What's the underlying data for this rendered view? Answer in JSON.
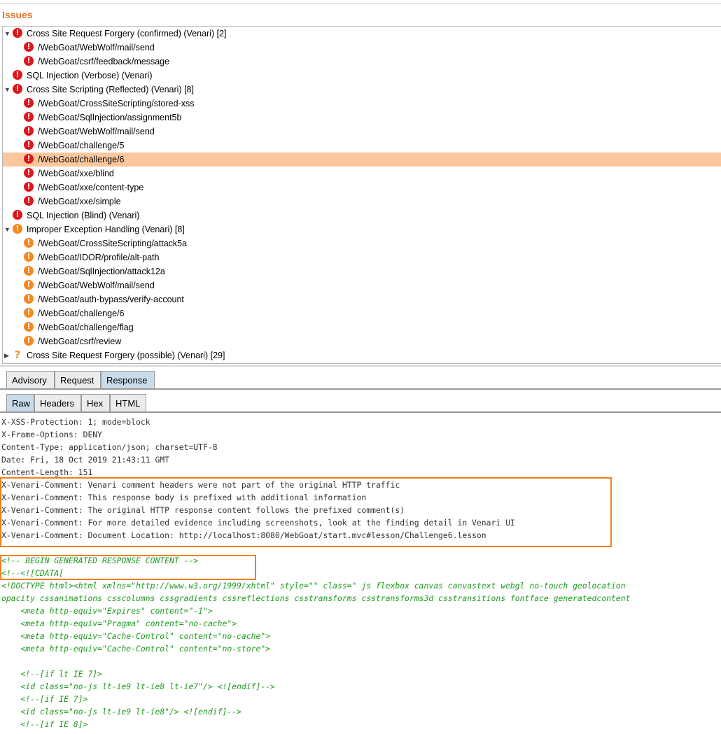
{
  "panel_title": "Issues",
  "tree": [
    {
      "level": 0,
      "expand": "down",
      "icon": "high",
      "label": "Cross Site Request Forgery (confirmed) (Venari) [2]"
    },
    {
      "level": 1,
      "icon": "high",
      "label": "/WebGoat/WebWolf/mail/send"
    },
    {
      "level": 1,
      "icon": "high",
      "label": "/WebGoat/csrf/feedback/message"
    },
    {
      "level": 0,
      "expand": "",
      "icon": "high",
      "label": "SQL Injection (Verbose) (Venari)"
    },
    {
      "level": 0,
      "expand": "down",
      "icon": "high",
      "label": "Cross Site Scripting (Reflected) (Venari) [8]"
    },
    {
      "level": 1,
      "icon": "high",
      "label": "/WebGoat/CrossSiteScripting/stored-xss"
    },
    {
      "level": 1,
      "icon": "high",
      "label": "/WebGoat/SqlInjection/assignment5b"
    },
    {
      "level": 1,
      "icon": "high",
      "label": "/WebGoat/WebWolf/mail/send"
    },
    {
      "level": 1,
      "icon": "high",
      "label": "/WebGoat/challenge/5"
    },
    {
      "level": 1,
      "icon": "high",
      "label": "/WebGoat/challenge/6",
      "selected": true
    },
    {
      "level": 1,
      "icon": "high",
      "label": "/WebGoat/xxe/blind"
    },
    {
      "level": 1,
      "icon": "high",
      "label": "/WebGoat/xxe/content-type"
    },
    {
      "level": 1,
      "icon": "high",
      "label": "/WebGoat/xxe/simple"
    },
    {
      "level": 0,
      "expand": "",
      "icon": "high",
      "label": "SQL Injection (Blind) (Venari)"
    },
    {
      "level": 0,
      "expand": "down",
      "icon": "med",
      "label": "Improper Exception Handling (Venari) [8]"
    },
    {
      "level": 1,
      "icon": "med",
      "label": "/WebGoat/CrossSiteScripting/attack5a"
    },
    {
      "level": 1,
      "icon": "med",
      "label": "/WebGoat/IDOR/profile/alt-path"
    },
    {
      "level": 1,
      "icon": "med",
      "label": "/WebGoat/SqlInjection/attack12a"
    },
    {
      "level": 1,
      "icon": "med",
      "label": "/WebGoat/WebWolf/mail/send"
    },
    {
      "level": 1,
      "icon": "med",
      "label": "/WebGoat/auth-bypass/verify-account"
    },
    {
      "level": 1,
      "icon": "med",
      "label": "/WebGoat/challenge/6"
    },
    {
      "level": 1,
      "icon": "med",
      "label": "/WebGoat/challenge/flag"
    },
    {
      "level": 1,
      "icon": "med",
      "label": "/WebGoat/csrf/review"
    },
    {
      "level": 0,
      "expand": "right",
      "icon": "question",
      "label": "Cross Site Request Forgery (possible) (Venari) [29]"
    }
  ],
  "tabs_main": [
    {
      "label": "Advisory",
      "active": false
    },
    {
      "label": "Request",
      "active": false
    },
    {
      "label": "Response",
      "active": true
    }
  ],
  "tabs_view": [
    {
      "label": "Raw",
      "active": true
    },
    {
      "label": "Headers",
      "active": false
    },
    {
      "label": "Hex",
      "active": false
    },
    {
      "label": "HTML",
      "active": false
    }
  ],
  "response_lines": [
    {
      "text": "X-XSS-Protection: 1; mode=block",
      "style": "plain"
    },
    {
      "text": "X-Frame-Options: DENY",
      "style": "plain"
    },
    {
      "text": "Content-Type: application/json; charset=UTF-8",
      "style": "plain"
    },
    {
      "text": "Date: Fri, 18 Oct 2019 21:43:11 GMT",
      "style": "plain"
    },
    {
      "text": "Content-Length: 151",
      "style": "plain"
    },
    {
      "text": "X-Venari-Comment: Venari comment headers were not part of the original HTTP traffic",
      "style": "plain"
    },
    {
      "text": "X-Venari-Comment: This response body is prefixed with additional information",
      "style": "plain"
    },
    {
      "text": "X-Venari-Comment: The original HTTP response content follows the prefixed comment(s)",
      "style": "plain"
    },
    {
      "text": "X-Venari-Comment: For more detailed evidence including screenshots, look at the finding detail in Venari UI",
      "style": "plain"
    },
    {
      "text": "X-Venari-Comment: Document Location: http://localhost:8080/WebGoat/start.mvc#lesson/Challenge6.lesson",
      "style": "plain"
    },
    {
      "text": "",
      "style": "plain"
    },
    {
      "text": "<!-- BEGIN GENERATED RESPONSE CONTENT -->",
      "style": "green"
    },
    {
      "text": "<!--<![CDATA[",
      "style": "green"
    },
    {
      "text": "<!DOCTYPE html><html xmlns=\"http://www.w3.org/1999/xhtml\" style=\"\" class=\" js flexbox canvas canvastext webgl no-touch geolocation",
      "style": "green"
    },
    {
      "text": "opacity cssanimations csscolumns cssgradients cssreflections csstransforms csstransforms3d csstransitions fontface generatedcontent",
      "style": "green"
    },
    {
      "text": "    <meta http-equiv=\"Expires\" content=\"-1\">",
      "style": "green"
    },
    {
      "text": "    <meta http-equiv=\"Pragma\" content=\"no-cache\">",
      "style": "green"
    },
    {
      "text": "    <meta http-equiv=\"Cache-Control\" content=\"no-cache\">",
      "style": "green"
    },
    {
      "text": "    <meta http-equiv=\"Cache-Control\" content=\"no-store\">",
      "style": "green"
    },
    {
      "text": "",
      "style": "green"
    },
    {
      "text": "    <!--[if lt IE 7]>",
      "style": "green"
    },
    {
      "text": "    <id class=\"no-js lt-ie9 lt-ie8 lt-ie7\"/> <![endif]-->",
      "style": "green"
    },
    {
      "text": "    <!--[if IE 7]>",
      "style": "green"
    },
    {
      "text": "    <id class=\"no-js lt-ie9 lt-ie8\"/> <![endif]-->",
      "style": "green"
    },
    {
      "text": "    <!--[if IE 8]>",
      "style": "green"
    }
  ]
}
